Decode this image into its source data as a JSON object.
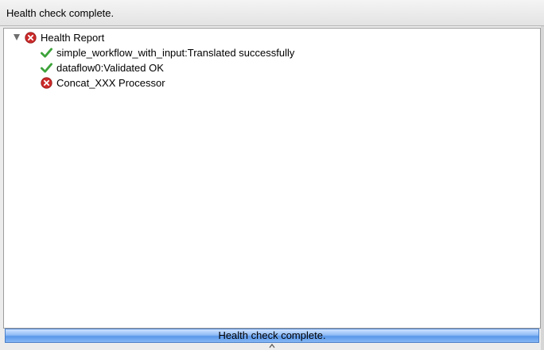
{
  "window": {
    "title": "Health check complete."
  },
  "tree": {
    "root": {
      "label": "Health Report",
      "status": "error",
      "expanded": true
    },
    "children": [
      {
        "label": "simple_workflow_with_input:Translated successfully",
        "status": "ok"
      },
      {
        "label": "dataflow0:Validated OK",
        "status": "ok"
      },
      {
        "label": "Concat_XXX Processor",
        "status": "error"
      }
    ]
  },
  "status_bar": {
    "text": "Health check complete."
  },
  "colors": {
    "error": "#cc2a2a",
    "ok": "#3da33a",
    "status_bar": "#6fa8f0"
  },
  "icons": {
    "expand": "disclosure-triangle-icon",
    "error": "error-x-icon",
    "ok": "checkmark-icon"
  }
}
